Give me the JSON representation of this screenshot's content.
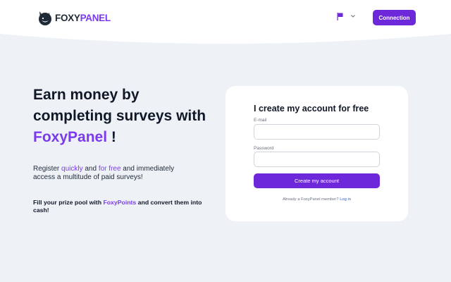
{
  "header": {
    "logo": {
      "name_part1": "FOXY",
      "name_part2": "PANEL"
    },
    "language_icon": "flag-icon",
    "language_dropdown_icon": "chevron-down-icon",
    "connection_label": "Connection"
  },
  "hero": {
    "title_line1": "Earn money by",
    "title_line2": "completing surveys with",
    "title_brand": "FoxyPanel",
    "title_suffix": " !",
    "desc_prefix": "Register ",
    "desc_quickly": "quickly",
    "desc_and": " and ",
    "desc_free": "for free",
    "desc_suffix": " and immediately access a multitude of paid surveys!",
    "prize_prefix": "Fill your prize pool with ",
    "prize_points": "FoxyPoints",
    "prize_suffix": " and convert them into cash!"
  },
  "signup": {
    "title": "I create my account for free",
    "email_label": "E-mail",
    "email_value": "",
    "password_label": "Password",
    "password_value": "",
    "submit_label": "Create my account",
    "already_text": "Already a FoxyPanel member? ",
    "login_link": "Log in"
  },
  "colors": {
    "accent": "#7c3aed",
    "button": "#6d28d9",
    "background": "#eef2f7",
    "link": "#2563eb"
  }
}
